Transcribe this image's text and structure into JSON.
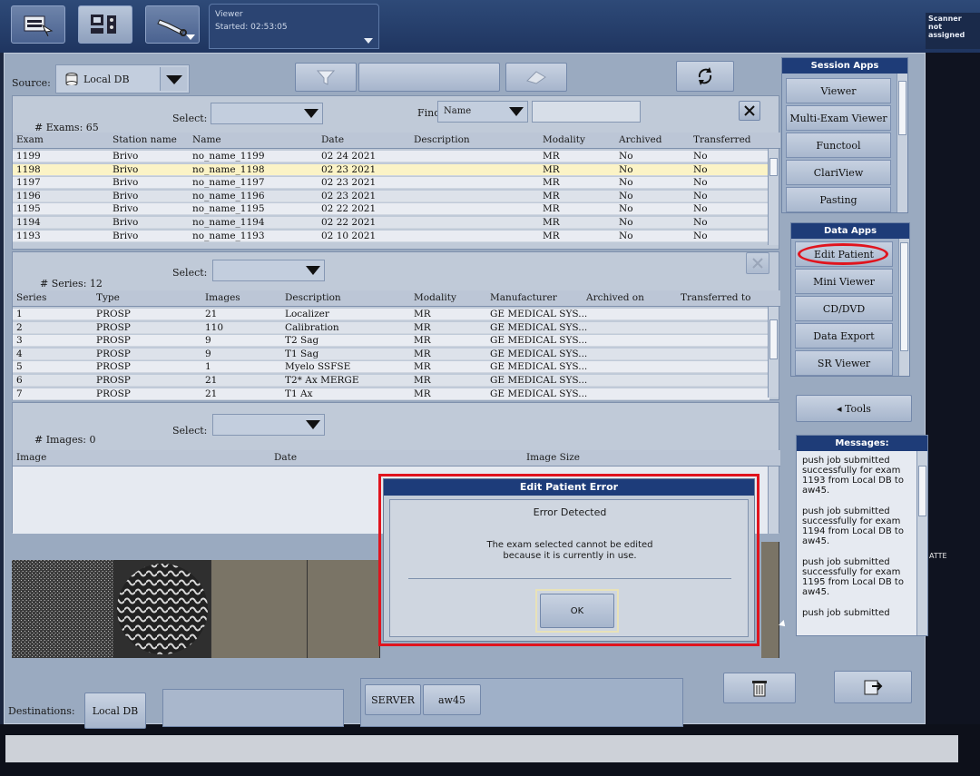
{
  "topbar": {
    "viewer_title": "Viewer",
    "viewer_started": "Started: 02:53:05",
    "scanner_title": "Scanner",
    "scanner_status": "not assigned"
  },
  "toolbar": {
    "source_label": "Source:",
    "source_value": "Local DB"
  },
  "exams": {
    "count_label": "# Exams:  65",
    "select_label": "Select:",
    "find_label": "Find:",
    "find_field": "Name",
    "columns": [
      "Exam",
      "Station name",
      "Name",
      "Date",
      "Description",
      "Modality",
      "Archived",
      "Transferred"
    ],
    "rows": [
      [
        "1199",
        "Brivo",
        "no_name_1199",
        "02 24 2021",
        "",
        "MR",
        "No",
        "No"
      ],
      [
        "1198",
        "Brivo",
        "no_name_1198",
        "02 23 2021",
        "",
        "MR",
        "No",
        "No"
      ],
      [
        "1197",
        "Brivo",
        "no_name_1197",
        "02 23 2021",
        "",
        "MR",
        "No",
        "No"
      ],
      [
        "1196",
        "Brivo",
        "no_name_1196",
        "02 23 2021",
        "",
        "MR",
        "No",
        "No"
      ],
      [
        "1195",
        "Brivo",
        "no_name_1195",
        "02 22 2021",
        "",
        "MR",
        "No",
        "No"
      ],
      [
        "1194",
        "Brivo",
        "no_name_1194",
        "02 22 2021",
        "",
        "MR",
        "No",
        "No"
      ],
      [
        "1193",
        "Brivo",
        "no_name_1193",
        "02 10 2021",
        "",
        "MR",
        "No",
        "No"
      ]
    ]
  },
  "series": {
    "count_label": "# Series:  12",
    "select_label": "Select:",
    "columns": [
      "Series",
      "Type",
      "Images",
      "Description",
      "Modality",
      "Manufacturer",
      "Archived on",
      "Transferred to"
    ],
    "rows": [
      [
        "1",
        "PROSP",
        "21",
        "Localizer",
        "MR",
        "GE MEDICAL SYS...",
        "",
        ""
      ],
      [
        "2",
        "PROSP",
        "110",
        "Calibration",
        "MR",
        "GE MEDICAL SYS...",
        "",
        ""
      ],
      [
        "3",
        "PROSP",
        "9",
        "T2 Sag",
        "MR",
        "GE MEDICAL SYS...",
        "",
        ""
      ],
      [
        "4",
        "PROSP",
        "9",
        "T1 Sag",
        "MR",
        "GE MEDICAL SYS...",
        "",
        ""
      ],
      [
        "5",
        "PROSP",
        "1",
        "Myelo SSFSE",
        "MR",
        "GE MEDICAL SYS...",
        "",
        ""
      ],
      [
        "6",
        "PROSP",
        "21",
        "T2* Ax MERGE",
        "MR",
        "GE MEDICAL SYS...",
        "",
        ""
      ],
      [
        "7",
        "PROSP",
        "21",
        "T1 Ax",
        "MR",
        "GE MEDICAL SYS...",
        "",
        ""
      ]
    ]
  },
  "images": {
    "count_label": "# Images:  0",
    "select_label": "Select:",
    "columns": [
      "Image",
      "Date",
      "Image Size"
    ]
  },
  "session_apps": {
    "title": "Session Apps",
    "items": [
      "Viewer",
      "Multi-Exam Viewer",
      "Functool",
      "ClariView",
      "Pasting"
    ]
  },
  "data_apps": {
    "title": "Data Apps",
    "items": [
      "Edit Patient",
      "Mini Viewer",
      "CD/DVD",
      "Data Export",
      "SR Viewer"
    ]
  },
  "tools_label": "◂ Tools",
  "messages": {
    "title": "Messages:",
    "lines": [
      "push job submitted successfully for exam 1193 from Local DB to aw45.",
      "push job submitted successfully for exam 1194 from Local DB to aw45.",
      "push job submitted successfully for exam 1195 from Local DB to aw45.",
      "push job submitted"
    ]
  },
  "dialog": {
    "title": "Edit Patient Error",
    "heading": "Error Detected",
    "message_line1": "The exam selected cannot be edited",
    "message_line2": "because it is currently in use.",
    "ok_label": "OK"
  },
  "destinations": {
    "label": "Destinations:",
    "local": "Local DB",
    "server": "SERVER",
    "aw": "aw45"
  },
  "side_text": "ATTE"
}
